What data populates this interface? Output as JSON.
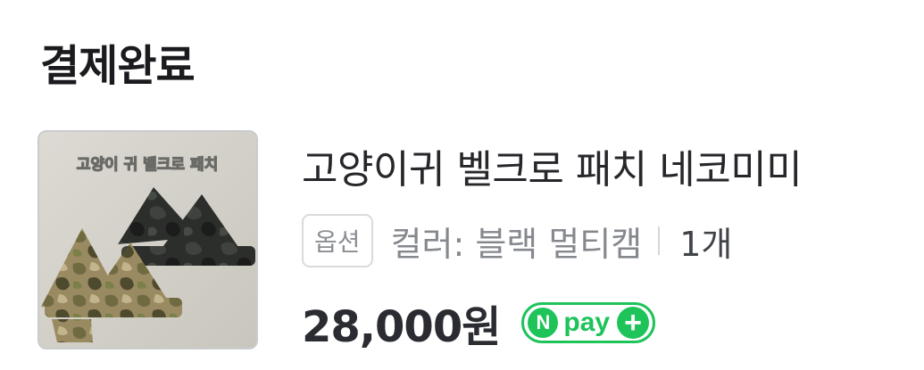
{
  "header": {
    "title": "결제완료"
  },
  "order_item": {
    "product_name": "고양이귀 벨크로 패치 네코미미",
    "thumbnail": {
      "caption": "고양이 귀 벨크로 패치"
    },
    "option": {
      "badge_label": "옵션",
      "value": "컬러: 블랙 멀티캠",
      "quantity": "1개"
    },
    "price": "28,000원",
    "payment_badge": {
      "n_letter": "N",
      "text": "pay",
      "plus": "+",
      "color": "#1ec35a"
    }
  }
}
